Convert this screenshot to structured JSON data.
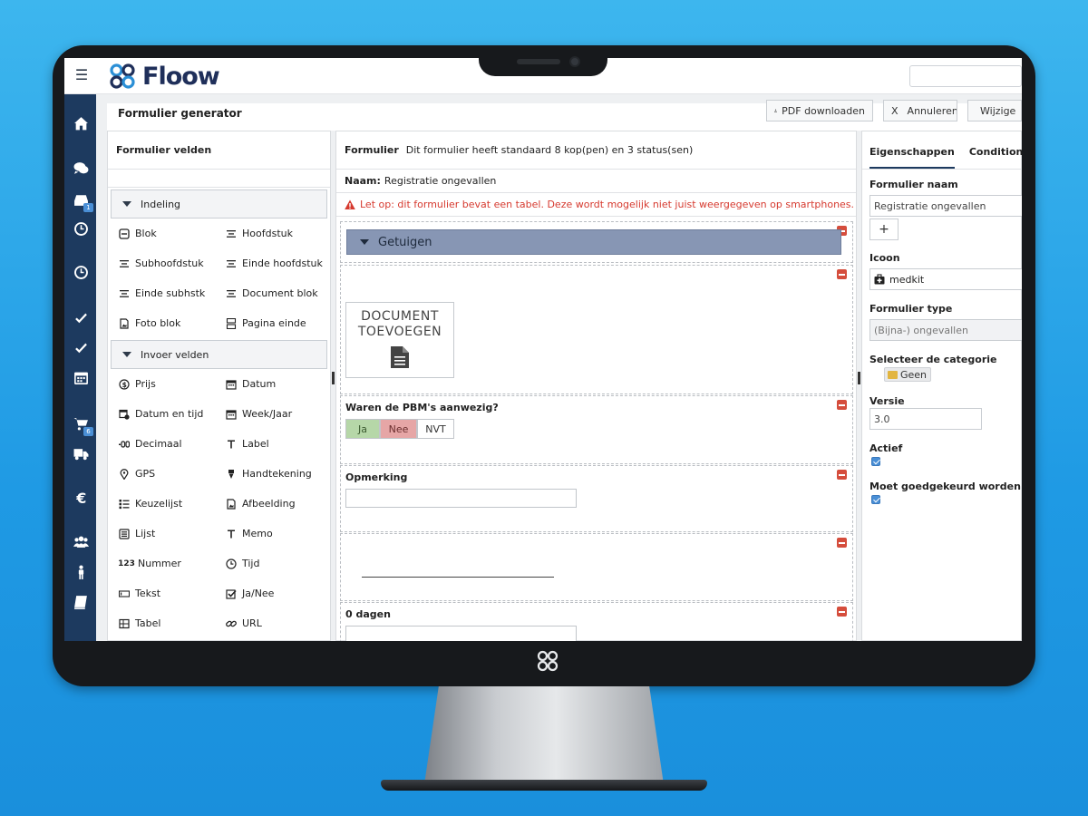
{
  "app": {
    "brand": "Floow",
    "page_title": "Formulier generator"
  },
  "header_buttons": {
    "pdf": "PDF downloaden",
    "cancel_x": "X",
    "cancel": "Annuleren",
    "edit": "Wijzige"
  },
  "left_panel": {
    "title": "Formulier velden",
    "groups": [
      {
        "label": "Indeling",
        "items": [
          {
            "label": "Blok",
            "icon": "minus-square-icon"
          },
          {
            "label": "Hoofdstuk",
            "icon": "align-icon"
          },
          {
            "label": "Subhoofdstuk",
            "icon": "align-icon"
          },
          {
            "label": "Einde hoofdstuk",
            "icon": "align-icon"
          },
          {
            "label": "Einde subhstk",
            "icon": "align-icon"
          },
          {
            "label": "Document blok",
            "icon": "align-icon"
          },
          {
            "label": "Foto blok",
            "icon": "image-icon"
          },
          {
            "label": "Pagina einde",
            "icon": "page-break-icon"
          }
        ]
      },
      {
        "label": "Invoer velden",
        "items": [
          {
            "label": "Prijs",
            "icon": "dollar-icon"
          },
          {
            "label": "Datum",
            "icon": "calendar-icon"
          },
          {
            "label": "Datum en tijd",
            "icon": "calendar-clock-icon"
          },
          {
            "label": "Week/Jaar",
            "icon": "calendar-icon"
          },
          {
            "label": "Decimaal",
            "icon": "decimal-icon"
          },
          {
            "label": "Label",
            "icon": "text-t-icon"
          },
          {
            "label": "GPS",
            "icon": "map-marker-icon"
          },
          {
            "label": "Handtekening",
            "icon": "pen-nib-icon"
          },
          {
            "label": "Keuzelijst",
            "icon": "list-icon"
          },
          {
            "label": "Afbeelding",
            "icon": "image-icon"
          },
          {
            "label": "Lijst",
            "icon": "list-alt-icon"
          },
          {
            "label": "Memo",
            "icon": "text-t-icon"
          },
          {
            "label": "Nummer",
            "icon": "number-icon"
          },
          {
            "label": "Tijd",
            "icon": "clock-icon"
          },
          {
            "label": "Tekst",
            "icon": "text-field-icon"
          },
          {
            "label": "Ja/Nee",
            "icon": "check-square-icon"
          },
          {
            "label": "Tabel",
            "icon": "table-icon"
          },
          {
            "label": "URL",
            "icon": "link-icon"
          }
        ]
      }
    ]
  },
  "mid_panel": {
    "title": "Formulier",
    "subtitle": "Dit formulier heeft standaard 8 kop(pen) en 3 status(sen)",
    "name_label": "Naam:",
    "name_value": "Registratie ongevallen",
    "warning": "Let op: dit formulier bevat een tabel. Deze wordt mogelijk niet juist weergegeven op smartphones.",
    "section": "Getuigen",
    "doc_button_line1": "DOCUMENT",
    "doc_button_line2": "TOEVOEGEN",
    "question": "Waren de PBM's aanwezig?",
    "options": [
      "Ja",
      "Nee",
      "NVT"
    ],
    "remark_label": "Opmerking",
    "days_label": "0 dagen"
  },
  "right_panel": {
    "tabs": [
      "Eigenschappen",
      "Conditionele"
    ],
    "form_name_label": "Formulier naam",
    "form_name_value": "Registratie ongevallen",
    "plus": "+",
    "icon_label": "Icoon",
    "icon_value": "medkit",
    "form_type_label": "Formulier type",
    "form_type_value": "(Bijna-) ongevallen",
    "category_label": "Selecteer de categorie",
    "category_value": "Geen",
    "version_label": "Versie",
    "version_value": "3.0",
    "active_label": "Actief",
    "active_checked": true,
    "approval_label": "Moet goedgekeurd worden",
    "approval_checked": true
  },
  "sidebar": {
    "badges": [
      "1",
      "6"
    ]
  },
  "colors": {
    "sidebar": "#1d3a5f",
    "section_bar": "#8796b4",
    "warning": "#d63a2f",
    "yes": "#b6d7a8",
    "no": "#e6a6a6"
  }
}
